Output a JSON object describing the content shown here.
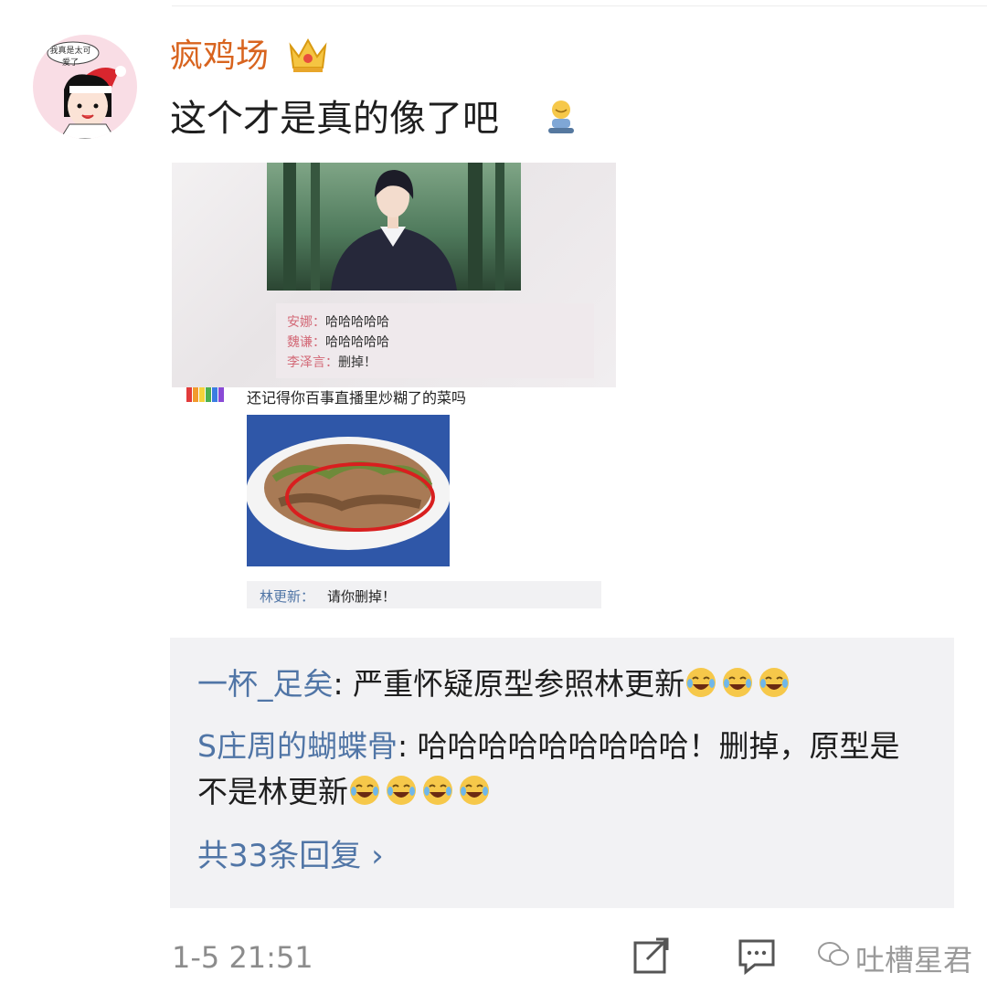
{
  "post": {
    "username": "疯鸡场",
    "avatar_caption": "我真是太可爱了",
    "text": "这个才是真的像了吧",
    "timestamp": "1-5 21:51"
  },
  "image": {
    "captions": [
      {
        "name": "安娜：",
        "text": "哈哈哈哈哈"
      },
      {
        "name": "魏谦：",
        "text": "哈哈哈哈哈"
      },
      {
        "name": "李泽言：",
        "text": "删掉！"
      }
    ],
    "comment": "还记得你百事直播里炒糊了的菜吗",
    "reply_name": "林更新：",
    "reply_text": "请你删掉！"
  },
  "replies": [
    {
      "name": "一杯_足矣",
      "text": ": 严重怀疑原型参照林更新",
      "emoji_count": 3,
      "emoji": "crying-laughing"
    },
    {
      "name": "S庄周的蝴蝶骨",
      "text": ": 哈哈哈哈哈哈哈哈哈！删掉，原型是不是林更新",
      "emoji_count": 4,
      "emoji": "laughing-tears"
    }
  ],
  "more_replies": "共33条回复 ›",
  "watermark": "吐槽星君",
  "colors": {
    "username": "#d8641f",
    "link": "#5075a6",
    "accent": "#d36a78"
  }
}
